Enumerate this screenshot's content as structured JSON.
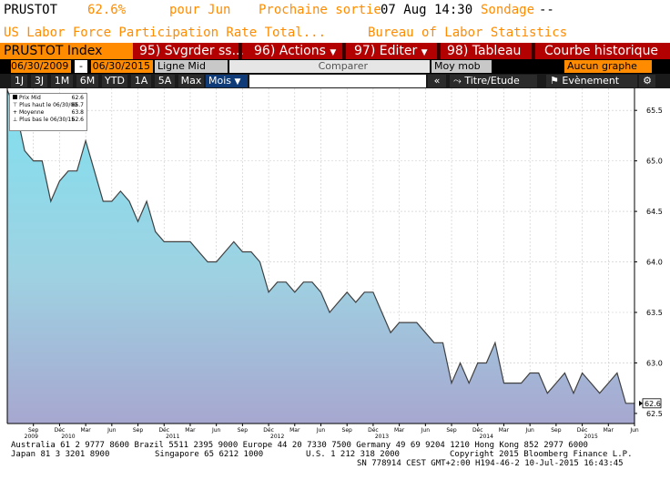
{
  "header": {
    "ticker": "PRUSTOT",
    "value": "62.6%",
    "period": "pour Jun",
    "next_release_label": "Prochaine sortie",
    "next_release_date": "07 Aug 14:30",
    "survey_label": "Sondage",
    "survey_value": "--",
    "description": "US Labor Force Participation Rate Total...",
    "source": "Bureau of Labor Statistics"
  },
  "menu": {
    "index_label": "PRUSTOT Index",
    "save_num": "95)",
    "save_label": "Svgrder ss...",
    "actions_num": "96)",
    "actions_label": "Actions",
    "edit_num": "97)",
    "edit_label": "Editer",
    "table_num": "98)",
    "table_label": "Tableau",
    "function_title": "Courbe historique"
  },
  "controls": {
    "start_date": "06/30/2009",
    "dash": "-",
    "end_date": "06/30/2015",
    "line_type": "Ligne Mid",
    "compare_label": "Comparer",
    "moving_avg": "Moy mob",
    "no_chart": "Aucun graphe indé"
  },
  "periods": [
    "1J",
    "3J",
    "1M",
    "6M",
    "YTD",
    "1A",
    "5A",
    "Max"
  ],
  "toolbar": {
    "frequency": "Mois",
    "collapse": "«",
    "study_label": "Titre/Etude",
    "event_label": "Evènement"
  },
  "legend": {
    "mid_label": "Prix Mid",
    "mid_value": "62.6",
    "high_label": "Plus haut le 06/30/09",
    "high_value": "65.7",
    "avg_label": "Moyenne",
    "avg_value": "63.8",
    "low_label": "Plus bas le 06/30/15",
    "low_value": "62.6"
  },
  "chart_data": {
    "type": "area",
    "series": [
      {
        "x": [
          "2009-06",
          "2009-07",
          "2009-08",
          "2009-09",
          "2009-10",
          "2009-11",
          "2009-12",
          "2010-01",
          "2010-02",
          "2010-03",
          "2010-04",
          "2010-05",
          "2010-06",
          "2010-07",
          "2010-08",
          "2010-09",
          "2010-10",
          "2010-11",
          "2010-12",
          "2011-01",
          "2011-02",
          "2011-03",
          "2011-04",
          "2011-05",
          "2011-06",
          "2011-07",
          "2011-08",
          "2011-09",
          "2011-10",
          "2011-11",
          "2011-12",
          "2012-01",
          "2012-02",
          "2012-03",
          "2012-04",
          "2012-05",
          "2012-06",
          "2012-07",
          "2012-08",
          "2012-09",
          "2012-10",
          "2012-11",
          "2012-12",
          "2013-01",
          "2013-02",
          "2013-03",
          "2013-04",
          "2013-05",
          "2013-06",
          "2013-07",
          "2013-08",
          "2013-09",
          "2013-10",
          "2013-11",
          "2013-12",
          "2014-01",
          "2014-02",
          "2014-03",
          "2014-04",
          "2014-05",
          "2014-06",
          "2014-07",
          "2014-08",
          "2014-09",
          "2014-10",
          "2014-11",
          "2014-12",
          "2015-01",
          "2015-02",
          "2015-03",
          "2015-04",
          "2015-05",
          "2015-06"
        ],
        "values": [
          65.7,
          65.5,
          65.1,
          65.0,
          65.0,
          64.6,
          64.8,
          64.9,
          64.9,
          65.2,
          64.9,
          64.6,
          64.6,
          64.7,
          64.6,
          64.4,
          64.6,
          64.3,
          64.2,
          64.2,
          64.2,
          64.2,
          64.1,
          64.0,
          64.0,
          64.1,
          64.2,
          64.1,
          64.1,
          64.0,
          63.7,
          63.8,
          63.8,
          63.7,
          63.8,
          63.8,
          63.7,
          63.5,
          63.6,
          63.7,
          63.6,
          63.7,
          63.7,
          63.5,
          63.3,
          63.4,
          63.4,
          63.4,
          63.3,
          63.2,
          63.2,
          62.8,
          63.0,
          62.8,
          63.0,
          63.0,
          63.2,
          62.8,
          62.8,
          62.8,
          62.9,
          62.9,
          62.7,
          62.8,
          62.9,
          62.7,
          62.9,
          62.8,
          62.7,
          62.8,
          62.9,
          62.6,
          62.6
        ]
      }
    ],
    "ylim": [
      62.4,
      65.7
    ],
    "y_ticks": [
      "62.5",
      "63.0",
      "63.5",
      "64.0",
      "64.5",
      "65.0",
      "65.5"
    ],
    "x_month_ticks": [
      "Sep",
      "Déc",
      "Mar",
      "Jun",
      "Sep",
      "Déc",
      "Mar",
      "Jun",
      "Sep",
      "Déc",
      "Mar",
      "Jun",
      "Sep",
      "Déc",
      "Mar",
      "Jun",
      "Sep",
      "Déc",
      "Mar",
      "Jun",
      "Sep",
      "Déc",
      "Mar",
      "Jun"
    ],
    "x_year_ticks": [
      "2009",
      "2010",
      "2011",
      "2012",
      "2013",
      "2014",
      "2015"
    ],
    "last_value_label": "62.6",
    "grid": true
  },
  "footer": {
    "line1": "Australia 61 2 9777 8600 Brazil 5511 2395 9000 Europe 44 20 7330 7500 Germany 49 69 9204 1210 Hong Kong 852 2977 6000",
    "line2_left": "Japan 81 3 3201 8900",
    "line2_mid": "Singapore 65 6212 1000",
    "line2_us": "U.S. 1 212 318 2000",
    "line2_copy": "Copyright 2015 Bloomberg Finance L.P.",
    "line3": "SN 778914 CEST GMT+2:00 H194-46-2 10-Jul-2015 16:43:45"
  },
  "colors": {
    "amber": "#ff8c00",
    "menu_red": "#b30000",
    "white_text": "#ffffff",
    "area_top": "#7fe0f0",
    "area_bottom": "#a7a7d0"
  }
}
